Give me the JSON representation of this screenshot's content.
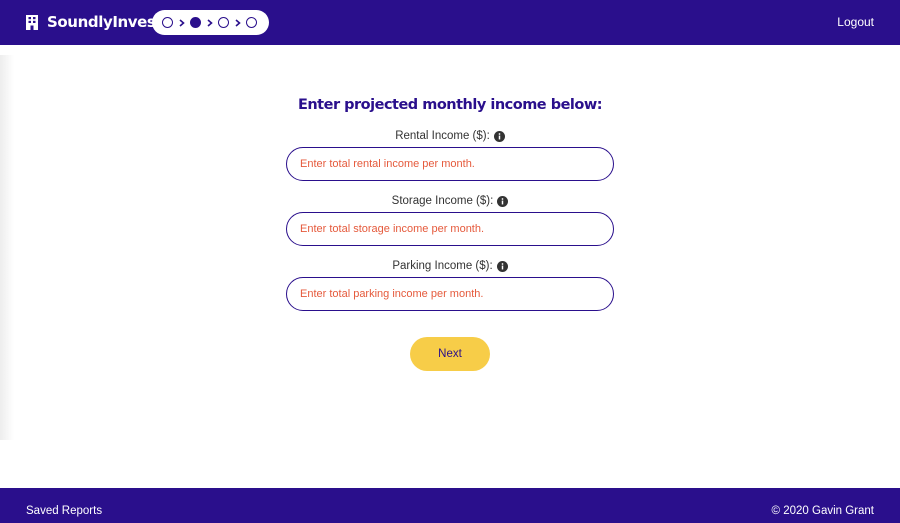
{
  "nav": {
    "brand": "SoundlyInvest",
    "logout_label": "Logout",
    "steps": [
      "empty",
      "filled",
      "empty",
      "empty"
    ],
    "current_step": 2
  },
  "form": {
    "title": "Enter projected monthly income below:",
    "fields": [
      {
        "label": "Rental Income ($):",
        "placeholder": "Enter total rental income per month.",
        "value": ""
      },
      {
        "label": "Storage Income ($):",
        "placeholder": "Enter total storage income per month.",
        "value": ""
      },
      {
        "label": "Parking Income ($):",
        "placeholder": "Enter total parking income per month.",
        "value": ""
      }
    ],
    "next_label": "Next"
  },
  "footer": {
    "saved_reports_label": "Saved Reports",
    "copyright": "© 2020 Gavin Grant"
  },
  "colors": {
    "primary": "#2a0f8c",
    "accent": "#f7cd48",
    "placeholder": "#e55a3c"
  },
  "icons": {
    "logo": "building-icon",
    "info": "info-circle-icon",
    "arrow": "chevron-right-icon"
  }
}
